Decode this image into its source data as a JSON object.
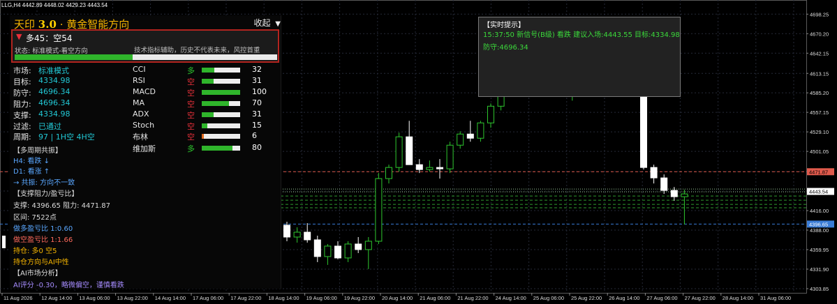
{
  "window": {
    "symbol_bar": "LLG,H4  4442.89 4448.02 4429.23 4443.54"
  },
  "panel": {
    "title_prefix": "天印",
    "title_version": "3.0",
    "title_suffix": "· 黄金智能方向",
    "collapse_label": "收起",
    "collapse_arrow": "▼",
    "signal_arrow": "▼",
    "signal_score": "多45：空54",
    "status_label": "状态: 标准模式-看空方向",
    "disclaimer": "技术指标辅助，历史不代表未来，风控首重",
    "long_pct": 0.45,
    "rows": [
      {
        "key": "市场:",
        "value": "标准模式",
        "color": "#22c9d6"
      },
      {
        "key": "目标:",
        "value": "4334.98",
        "color": "#22c9d6"
      },
      {
        "key": "防守:",
        "value": "4696.34",
        "color": "#22c9d6"
      },
      {
        "key": "阻力:",
        "value": "4696.34",
        "color": "#22c9d6"
      },
      {
        "key": "支撑:",
        "value": "4334.98",
        "color": "#22c9d6"
      },
      {
        "key": "过滤:",
        "value": "已通过",
        "color": "#22c9d6"
      },
      {
        "key": "周期:",
        "value": "97 | 1H空 4H空",
        "color": "#22c9d6"
      }
    ],
    "indicators": [
      {
        "name": "CCI",
        "dir": "多",
        "dir_color": "#2ec72e",
        "value": "32",
        "bar_pct": 0.32,
        "bar_color": "#2fb52b"
      },
      {
        "name": "RSI",
        "dir": "空",
        "dir_color": "#e8303a",
        "value": "31",
        "bar_pct": 0.31,
        "bar_color": "#2fb52b"
      },
      {
        "name": "MACD",
        "dir": "空",
        "dir_color": "#e8303a",
        "value": "100",
        "bar_pct": 1.0,
        "bar_color": "#2fb52b"
      },
      {
        "name": "MA",
        "dir": "空",
        "dir_color": "#e8303a",
        "value": "70",
        "bar_pct": 0.7,
        "bar_color": "#2fb52b"
      },
      {
        "name": "ADX",
        "dir": "空",
        "dir_color": "#e8303a",
        "value": "31",
        "bar_pct": 0.31,
        "bar_color": "#2fb52b"
      },
      {
        "name": "Stoch",
        "dir": "空",
        "dir_color": "#e8303a",
        "value": "15",
        "bar_pct": 0.15,
        "bar_color": "#2fb52b"
      },
      {
        "name": "布林",
        "dir": "空",
        "dir_color": "#e8303a",
        "value": "6",
        "bar_pct": 0.06,
        "bar_color": "#e06a1e"
      },
      {
        "name": "维加斯",
        "dir": "多",
        "dir_color": "#2ec72e",
        "value": "80",
        "bar_pct": 0.8,
        "bar_color": "#2fb52b"
      }
    ],
    "mtf_header": "【多周期共振】",
    "mtf": [
      {
        "text": "H4: 看跌 ↓",
        "color": "#5aa7ff"
      },
      {
        "text": "D1: 看涨 ↑",
        "color": "#5aa7ff"
      }
    ],
    "resonance": "→ 共振: 方向不一致",
    "sr_header": "【支撑阻力/盈亏比】",
    "sr_line": "支撑: 4396.65  阻力: 4471.87",
    "range": "区间: 7522点",
    "long_ratio": "做多盈亏比 1:0.60",
    "short_ratio": "做空盈亏比 1:1.66",
    "position": "持仓: 多0 空5",
    "position_ai": "持仓方向与AI中性",
    "ai_header": "【AI市场分析】",
    "ai_score": "AI评分 -0.30，略微偏空，谨慎看跌"
  },
  "tooltip": {
    "title": "【实时提示】",
    "line1": "15:37:50 新信号(B级) 看跌 建议入场:4443.55 目标:4334.98",
    "line2": "防守:4696.34"
  },
  "chart_data": {
    "type": "candlestick",
    "symbol": "LLG",
    "timeframe": "H4",
    "ohlc_header": [
      "4442.89",
      "4448.02",
      "4429.23",
      "4443.54"
    ],
    "y_ticks": [
      4698.25,
      4670.2,
      4642.15,
      4613.15,
      4585.2,
      4557.15,
      4529.1,
      4501.05,
      4472.1,
      4444.05,
      4416.0,
      4388.0,
      4359.95,
      4331.9,
      4303.85
    ],
    "y_range": [
      4300,
      4720
    ],
    "x_ticks": [
      "11 Aug 2026",
      "12 Aug 14:00",
      "13 Aug 06:00",
      "13 Aug 22:00",
      "14 Aug 14:00",
      "17 Aug 06:00",
      "17 Aug 22:00",
      "18 Aug 14:00",
      "19 Aug 06:00",
      "19 Aug 22:00",
      "20 Aug 14:00",
      "21 Aug 06:00",
      "21 Aug 22:00",
      "24 Aug 14:00",
      "25 Aug 06:00",
      "25 Aug 22:00",
      "26 Aug 14:00",
      "27 Aug 06:00",
      "27 Aug 22:00",
      "28 Aug 14:00",
      "31 Aug 06:00"
    ],
    "price_tags": [
      {
        "label": "4471.87",
        "price": 4471.87,
        "bg": "#e05a4c",
        "fg": "#000"
      },
      {
        "label": "4443.54",
        "price": 4443.54,
        "bg": "#ffffff",
        "fg": "#000"
      },
      {
        "label": "4396.65",
        "price": 4396.65,
        "bg": "#3a7cd6",
        "fg": "#fff"
      }
    ],
    "levels": [
      {
        "price": 4471.87,
        "style": "dash",
        "color": "#e05a4c"
      },
      {
        "price": 4396.65,
        "style": "dash",
        "color": "#3a7cd6"
      },
      {
        "price": 4447,
        "style": "dot",
        "color": "#9ccc9c"
      },
      {
        "price": 4443,
        "style": "dot",
        "color": "#9ccc9c"
      },
      {
        "price": 4437,
        "style": "dash",
        "color": "#2f9b2f"
      },
      {
        "price": 4431,
        "style": "dash",
        "color": "#2f9b2f"
      },
      {
        "price": 4425,
        "style": "dash",
        "color": "#2f9b2f"
      },
      {
        "price": 4420,
        "style": "dash",
        "color": "#2f9b2f"
      }
    ],
    "candles": [
      [
        4395,
        4400,
        4372,
        4378
      ],
      [
        4378,
        4392,
        4370,
        4385
      ],
      [
        4385,
        4398,
        4370,
        4374
      ],
      [
        4374,
        4380,
        4342,
        4350
      ],
      [
        4350,
        4368,
        4338,
        4365
      ],
      [
        4365,
        4372,
        4346,
        4348
      ],
      [
        4348,
        4372,
        4342,
        4368
      ],
      [
        4368,
        4378,
        4355,
        4360
      ],
      [
        4360,
        4378,
        4332,
        4372
      ],
      [
        4372,
        4470,
        4368,
        4462
      ],
      [
        4462,
        4482,
        4455,
        4478
      ],
      [
        4478,
        4528,
        4472,
        4522
      ],
      [
        4522,
        4545,
        4490,
        4482
      ],
      [
        4482,
        4490,
        4470,
        4475
      ],
      [
        4475,
        4488,
        4472,
        4478
      ],
      [
        4478,
        4490,
        4462,
        4476
      ],
      [
        4476,
        4515,
        4470,
        4510
      ],
      [
        4510,
        4530,
        4505,
        4526
      ],
      [
        4526,
        4545,
        4515,
        4520
      ],
      [
        4520,
        4545,
        4515,
        4542
      ],
      [
        4542,
        4570,
        4535,
        4566
      ],
      [
        4566,
        4602,
        4560,
        4598
      ],
      [
        4598,
        4632,
        4592,
        4628
      ],
      [
        4628,
        4642,
        4598,
        4602
      ],
      [
        4602,
        4652,
        4598,
        4645
      ],
      [
        4645,
        4650,
        4610,
        4615
      ],
      [
        4615,
        4635,
        4605,
        4628
      ],
      [
        4628,
        4660,
        4622,
        4655
      ],
      [
        4580,
        4605,
        4574,
        4598
      ],
      [
        4598,
        4612,
        4585,
        4592
      ],
      [
        4592,
        4622,
        4588,
        4615
      ],
      [
        4615,
        4620,
        4590,
        4596
      ],
      [
        4596,
        4612,
        4585,
        4608
      ],
      [
        4608,
        4615,
        4590,
        4596
      ],
      [
        4596,
        4618,
        4588,
        4610
      ],
      [
        4610,
        4628,
        4475,
        4478
      ],
      [
        4478,
        4482,
        4455,
        4463
      ],
      [
        4463,
        4468,
        4440,
        4445
      ],
      [
        4445,
        4450,
        4430,
        4436
      ],
      [
        4436,
        4446,
        4396,
        4440
      ]
    ]
  }
}
